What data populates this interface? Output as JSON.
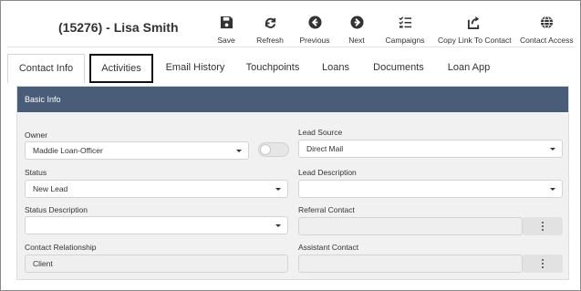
{
  "header": {
    "title": "(15276) - Lisa Smith",
    "toolbar": [
      {
        "id": "save",
        "label": "Save",
        "icon": "save-icon"
      },
      {
        "id": "refresh",
        "label": "Refresh",
        "icon": "refresh-icon"
      },
      {
        "id": "previous",
        "label": "Previous",
        "icon": "arrow-left-circle-icon"
      },
      {
        "id": "next",
        "label": "Next",
        "icon": "arrow-right-circle-icon"
      },
      {
        "id": "campaigns",
        "label": "Campaigns",
        "icon": "checklist-icon"
      },
      {
        "id": "copy_link",
        "label": "Copy Link To Contact",
        "icon": "share-icon"
      },
      {
        "id": "contact_access",
        "label": "Contact Access",
        "icon": "globe-icon"
      }
    ]
  },
  "tabs": [
    {
      "label": "Contact Info",
      "active": true
    },
    {
      "label": "Activities",
      "highlighted": true
    },
    {
      "label": "Email History"
    },
    {
      "label": "Touchpoints"
    },
    {
      "label": "Loans"
    },
    {
      "label": "Documents"
    },
    {
      "label": "Loan App"
    }
  ],
  "panel": {
    "title": "Basic Info",
    "owner": {
      "label": "Owner",
      "value": "Maddie Loan-Officer"
    },
    "lead_source": {
      "label": "Lead Source",
      "value": "Direct Mail"
    },
    "status": {
      "label": "Status",
      "value": "New Lead"
    },
    "lead_description": {
      "label": "Lead Description",
      "value": ""
    },
    "status_description": {
      "label": "Status Description",
      "value": ""
    },
    "referral_contact": {
      "label": "Referral Contact",
      "value": ""
    },
    "contact_relationship": {
      "label": "Contact Relationship",
      "value": "Client"
    },
    "assistant_contact": {
      "label": "Assistant Contact",
      "value": ""
    }
  },
  "colors": {
    "panel_header": "#4a5d78",
    "highlight_border": "#111111"
  }
}
